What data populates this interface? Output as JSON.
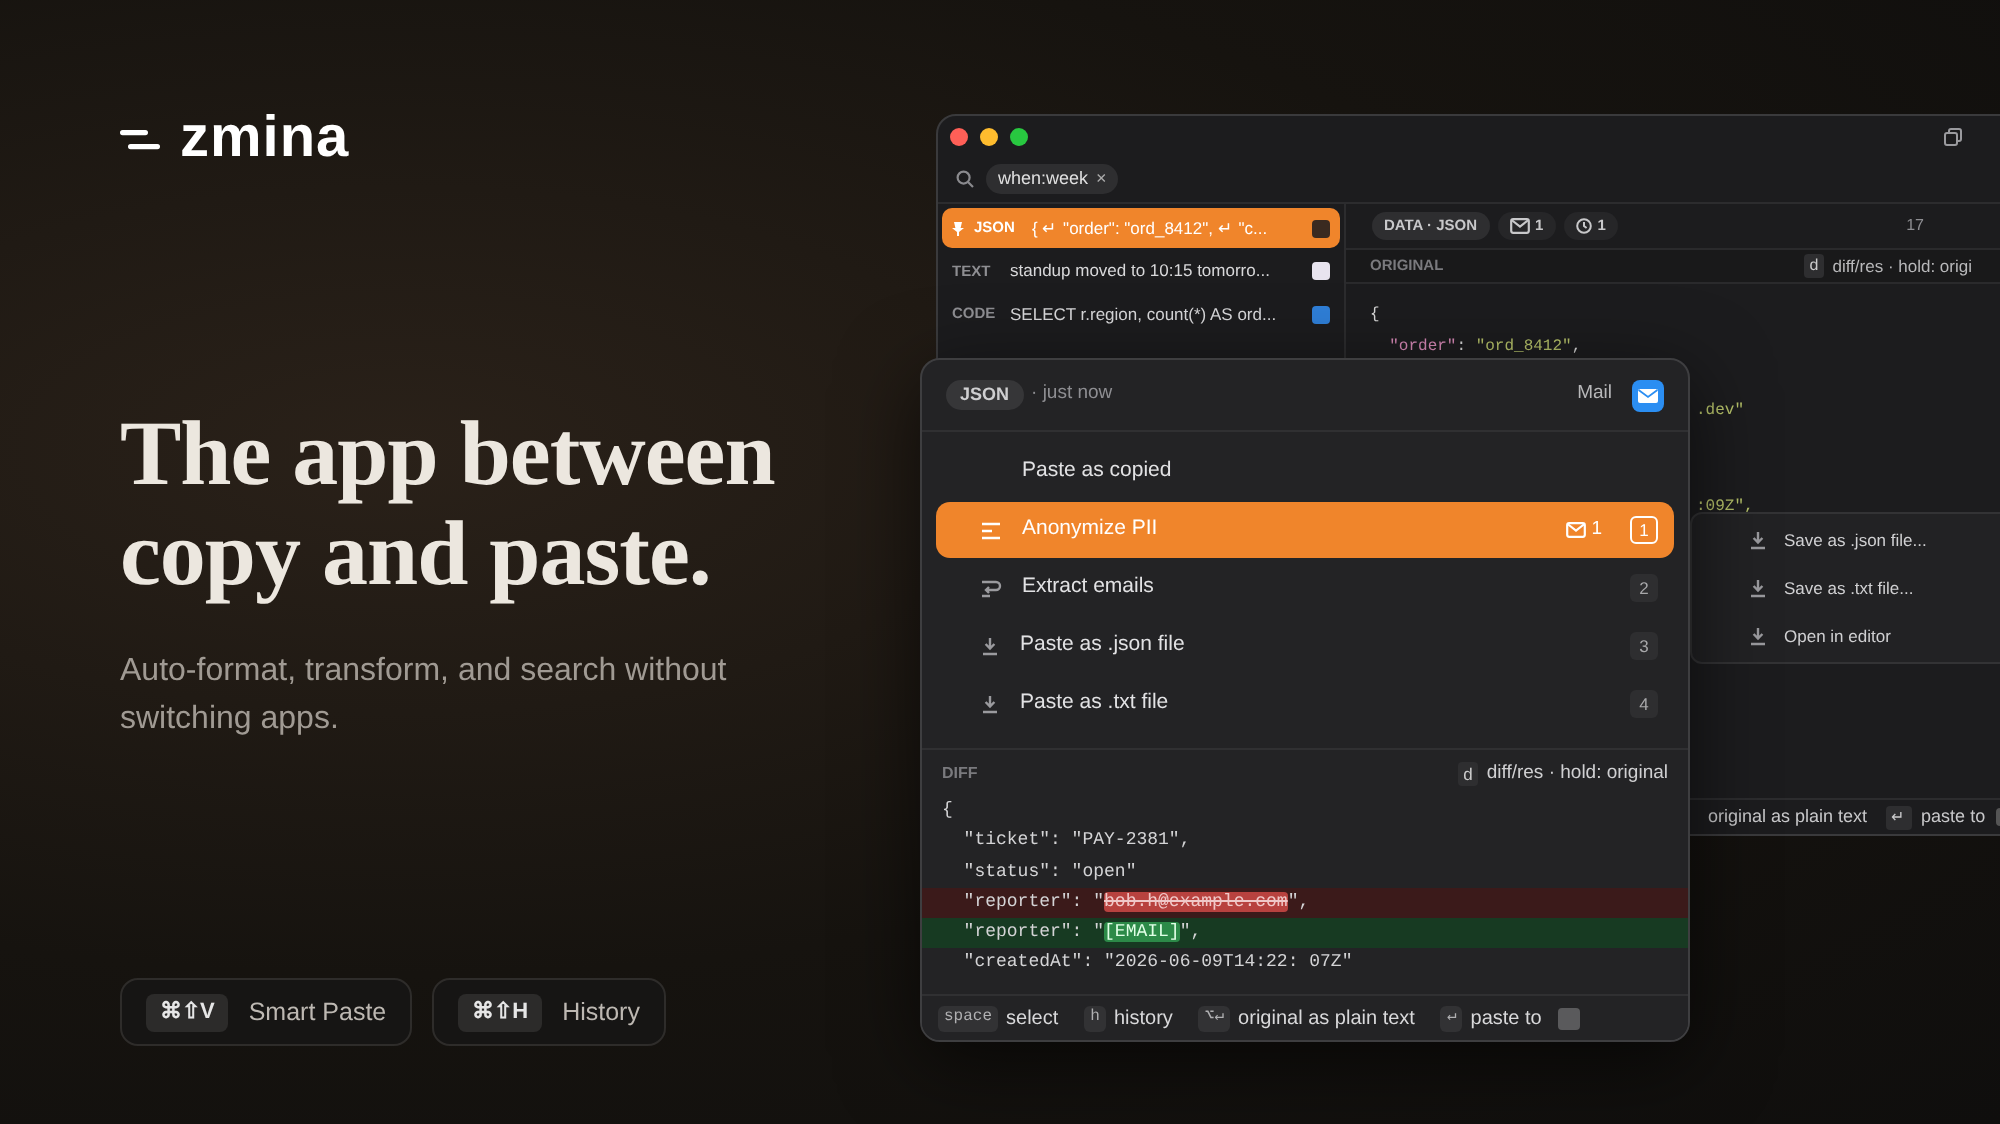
{
  "brand": {
    "name": "zmina"
  },
  "hero": {
    "headline_lines": [
      "The app between",
      "copy and paste."
    ],
    "subtitle": "Auto-format, transform, and search without switching apps."
  },
  "shortcuts": [
    {
      "keys": "⌘⇧V",
      "label": "Smart Paste"
    },
    {
      "keys": "⌘⇧H",
      "label": "History"
    }
  ],
  "history_window": {
    "search": {
      "chip": "when:week",
      "chip_close": "×"
    },
    "items": [
      {
        "tag": "JSON",
        "text": "{ ↵ \"order\": \"ord_8412\", ↵ \"c...",
        "selected": true,
        "pinned": true,
        "color": "#3a2a20"
      },
      {
        "tag": "TEXT",
        "text": "standup moved to 10:15 tomorro...",
        "selected": false,
        "pinned": false,
        "color": "#e8e4ef"
      },
      {
        "tag": "CODE",
        "text": "SELECT r.region, count(*) AS ord...",
        "selected": false,
        "pinned": false,
        "color": "#2f7fd8"
      }
    ],
    "detail": {
      "chips": [
        {
          "kind": "type",
          "label": "DATA · JSON"
        },
        {
          "kind": "mail",
          "label": "1"
        },
        {
          "kind": "clock",
          "label": "1"
        }
      ],
      "count": "17",
      "section": "ORIGINAL",
      "key": "d",
      "hint": "diff/res · hold: origi",
      "code": [
        {
          "kind": "full",
          "text": "{"
        },
        {
          "kind": "full",
          "text": "  \"order\": \"ord_8412\","
        },
        {
          "kind": "gap"
        },
        {
          "kind": "clipped",
          "text": ".dev\""
        },
        {
          "kind": "gap"
        },
        {
          "kind": "gap"
        },
        {
          "kind": "clipped",
          "text": ":09Z\","
        }
      ]
    },
    "menu": [
      {
        "label": "Save as .json file..."
      },
      {
        "label": "Save as .txt file..."
      },
      {
        "label": "Open in editor"
      }
    ],
    "footer": {
      "text": "original as plain text",
      "key": "↵",
      "action": "paste to"
    }
  },
  "paste_popup": {
    "type": "JSON",
    "time": "· just now",
    "app": "Mail",
    "actions": [
      {
        "kind": "plain",
        "label": "Paste as copied",
        "selected": false
      },
      {
        "kind": "anonymize",
        "label": "Anonymize PII",
        "selected": true,
        "badge": "1",
        "shortcut": "1"
      },
      {
        "kind": "extract",
        "label": "Extract emails",
        "selected": false,
        "shortcut": "2"
      },
      {
        "kind": "download",
        "label": "Paste as .json file",
        "selected": false,
        "shortcut": "3"
      },
      {
        "kind": "download",
        "label": "Paste as .txt file",
        "selected": false,
        "shortcut": "4"
      }
    ],
    "diff": {
      "title": "DIFF",
      "key": "d",
      "hint": "diff/res · hold: original",
      "lines": [
        {
          "kind": "same",
          "before": "{"
        },
        {
          "kind": "same",
          "before": "  \"ticket\": \"PAY-2381\","
        },
        {
          "kind": "same",
          "before": "  \"status\": \"open\""
        },
        {
          "kind": "removed",
          "before": "  \"reporter\": \"",
          "mark": "bob.h@example.com",
          "after": "\","
        },
        {
          "kind": "added",
          "before": "  \"reporter\": \"",
          "mark": "[EMAIL]",
          "after": "\","
        },
        {
          "kind": "same",
          "before": "  \"createdAt\": \"2026-06-09T14:22: 07Z\""
        }
      ]
    },
    "footer": [
      {
        "key": "space",
        "label": "select"
      },
      {
        "key": "h",
        "label": "history"
      },
      {
        "key": "⌥↵",
        "label": "original as plain text"
      },
      {
        "key": "↵",
        "label": "paste to"
      }
    ]
  }
}
